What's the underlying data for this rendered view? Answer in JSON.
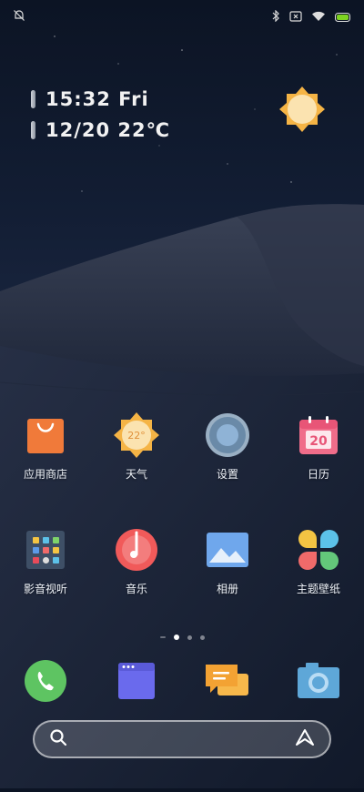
{
  "status_bar": {
    "icons": [
      "bell-muted-icon",
      "bluetooth-icon",
      "sim-x-icon",
      "wifi-icon",
      "battery-icon"
    ],
    "battery_color": "#7ed321"
  },
  "clock_widget": {
    "time_line": "15:32 Fri",
    "date_line": "12/20 22℃",
    "weather_icon": "sun-icon"
  },
  "apps_row1": [
    {
      "label": "应用商店",
      "icon": "shopping-bag-icon"
    },
    {
      "label": "天气",
      "icon": "weather-sun-icon",
      "badge": "22°"
    },
    {
      "label": "设置",
      "icon": "gear-icon"
    },
    {
      "label": "日历",
      "icon": "calendar-icon",
      "badge": "20"
    }
  ],
  "apps_row2": [
    {
      "label": "影音视听",
      "icon": "media-grid-icon"
    },
    {
      "label": "音乐",
      "icon": "music-icon"
    },
    {
      "label": "相册",
      "icon": "gallery-icon"
    },
    {
      "label": "主题壁纸",
      "icon": "themes-petal-icon"
    }
  ],
  "page_indicator": {
    "pages": 3,
    "active": 0
  },
  "dock": [
    {
      "icon": "phone-icon"
    },
    {
      "icon": "browser-icon"
    },
    {
      "icon": "messages-icon"
    },
    {
      "icon": "camera-icon"
    }
  ],
  "search_bar": {
    "left_icon": "search-icon",
    "right_icon": "assistant-icon"
  }
}
